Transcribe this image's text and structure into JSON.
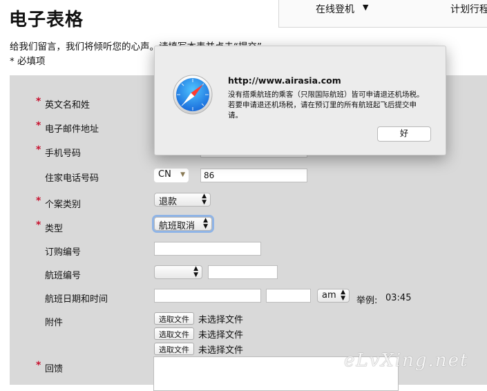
{
  "page": {
    "title": "电子表格",
    "intro": "给我们留言，我们将倾听您的心声。请填写本表并点击“提交”。",
    "required_note": "* 必填项"
  },
  "topnav": {
    "login": "在线登机",
    "plan": "计划行程"
  },
  "form": {
    "name_label": "英文名和姓",
    "email_label": "电子邮件地址",
    "mobile_label": "手机号码",
    "home_phone_label": "住家电话号码",
    "home_phone_country": "CN",
    "home_phone_code": "86",
    "case_type_label": "个案类别",
    "case_type_value": "退款",
    "type_label": "类型",
    "type_value": "航班取消",
    "booking_label": "订购编号",
    "flight_label": "航班编号",
    "flight_datetime_label": "航班日期和时间",
    "ampm_value": "am",
    "example_label": "举例:",
    "example_time": "03:45",
    "attachment_label": "附件",
    "file_button": "选取文件",
    "no_file": "未选择文件",
    "feedback_label": "回馈",
    "required_mark": "*"
  },
  "dialog": {
    "url": "http://www.airasia.com",
    "message": "没有搭乘航班的乘客（只限国际航班）皆可申请退还机场税。若要申请退还机场税，请在预订里的所有航班起飞后提交申请。",
    "ok_label": "好",
    "icon": "safari-compass-icon"
  },
  "watermark": "eLvXing.net"
}
